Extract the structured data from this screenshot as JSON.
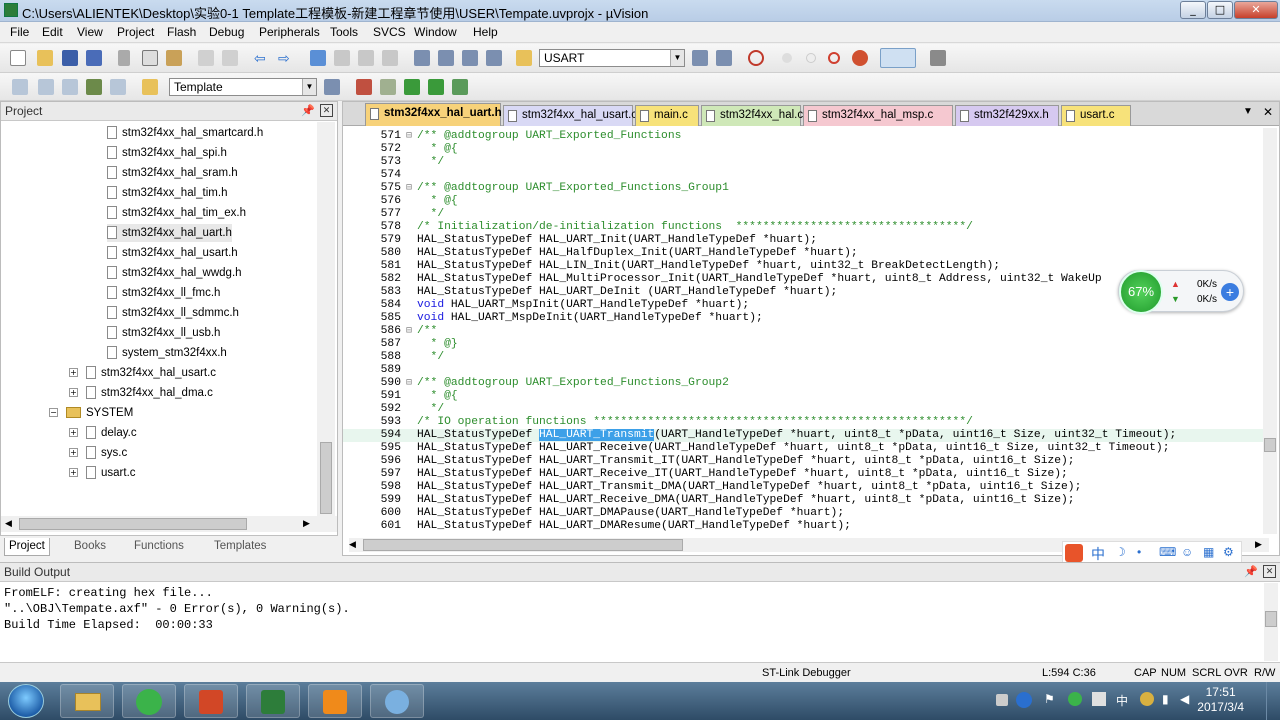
{
  "window": {
    "title": "C:\\Users\\ALIENTEK\\Desktop\\实验0-1 Template工程模板-新建工程章节使用\\USER\\Tempate.uvprojx - µVision"
  },
  "menu": [
    "File",
    "Edit",
    "View",
    "Project",
    "Flash",
    "Debug",
    "Peripherals",
    "Tools",
    "SVCS",
    "Window",
    "Help"
  ],
  "toolbar": {
    "find_value": "USART",
    "target_value": "Template"
  },
  "project_panel": {
    "title": "Project",
    "files": [
      "stm32f4xx_hal_smartcard.h",
      "stm32f4xx_hal_spi.h",
      "stm32f4xx_hal_sram.h",
      "stm32f4xx_hal_tim.h",
      "stm32f4xx_hal_tim_ex.h",
      "stm32f4xx_hal_uart.h",
      "stm32f4xx_hal_usart.h",
      "stm32f4xx_hal_wwdg.h",
      "stm32f4xx_ll_fmc.h",
      "stm32f4xx_ll_sdmmc.h",
      "stm32f4xx_ll_usb.h",
      "system_stm32f4xx.h"
    ],
    "sources": [
      "stm32f4xx_hal_usart.c",
      "stm32f4xx_hal_dma.c"
    ],
    "group": "SYSTEM",
    "group_files": [
      "delay.c",
      "sys.c",
      "usart.c"
    ],
    "tabs": [
      "Project",
      "Books",
      "Functions",
      "Templates"
    ]
  },
  "editor": {
    "tabs": [
      {
        "label": "stm32f4xx_hal_uart.h",
        "color": "#f7d27a",
        "active": true
      },
      {
        "label": "stm32f4xx_hal_usart.c",
        "color": "#d9d9f5"
      },
      {
        "label": "main.c",
        "color": "#f7e27a"
      },
      {
        "label": "stm32f4xx_hal.c",
        "color": "#cfe8b8"
      },
      {
        "label": "stm32f4xx_hal_msp.c",
        "color": "#f5c8d0"
      },
      {
        "label": "stm32f429xx.h",
        "color": "#d6c9f0"
      },
      {
        "label": "usart.c",
        "color": "#f7e27a"
      }
    ],
    "lines": [
      {
        "n": "571",
        "f": "⊟",
        "t": "/** @addtogroup UART_Exported_Functions",
        "c": "cmt"
      },
      {
        "n": "572",
        "f": "",
        "t": "  * @{",
        "c": "cmt"
      },
      {
        "n": "573",
        "f": "",
        "t": "  */",
        "c": "cmt"
      },
      {
        "n": "574",
        "f": "",
        "t": "",
        "c": ""
      },
      {
        "n": "575",
        "f": "⊟",
        "t": "/** @addtogroup UART_Exported_Functions_Group1",
        "c": "cmt"
      },
      {
        "n": "576",
        "f": "",
        "t": "  * @{",
        "c": "cmt"
      },
      {
        "n": "577",
        "f": "",
        "t": "  */",
        "c": "cmt"
      },
      {
        "n": "578",
        "f": "",
        "t": "/* Initialization/de-initialization functions  **********************************/",
        "c": "cmt"
      },
      {
        "n": "579",
        "f": "",
        "t": "HAL_StatusTypeDef HAL_UART_Init(UART_HandleTypeDef *huart);",
        "c": ""
      },
      {
        "n": "580",
        "f": "",
        "t": "HAL_StatusTypeDef HAL_HalfDuplex_Init(UART_HandleTypeDef *huart);",
        "c": ""
      },
      {
        "n": "581",
        "f": "",
        "t": "HAL_StatusTypeDef HAL_LIN_Init(UART_HandleTypeDef *huart, uint32_t BreakDetectLength);",
        "c": ""
      },
      {
        "n": "582",
        "f": "",
        "t": "HAL_StatusTypeDef HAL_MultiProcessor_Init(UART_HandleTypeDef *huart, uint8_t Address, uint32_t WakeUp",
        "c": ""
      },
      {
        "n": "583",
        "f": "",
        "t": "HAL_StatusTypeDef HAL_UART_DeInit (UART_HandleTypeDef *huart);",
        "c": ""
      },
      {
        "n": "584",
        "f": "",
        "t": "void HAL_UART_MspInit(UART_HandleTypeDef *huart);",
        "c": "void"
      },
      {
        "n": "585",
        "f": "",
        "t": "void HAL_UART_MspDeInit(UART_HandleTypeDef *huart);",
        "c": "void"
      },
      {
        "n": "586",
        "f": "⊟",
        "t": "/**",
        "c": "cmt"
      },
      {
        "n": "587",
        "f": "",
        "t": "  * @}",
        "c": "cmt"
      },
      {
        "n": "588",
        "f": "",
        "t": "  */",
        "c": "cmt"
      },
      {
        "n": "589",
        "f": "",
        "t": "",
        "c": ""
      },
      {
        "n": "590",
        "f": "⊟",
        "t": "/** @addtogroup UART_Exported_Functions_Group2",
        "c": "cmt"
      },
      {
        "n": "591",
        "f": "",
        "t": "  * @{",
        "c": "cmt"
      },
      {
        "n": "592",
        "f": "",
        "t": "  */",
        "c": "cmt"
      },
      {
        "n": "593",
        "f": "",
        "t": "/* IO operation functions *******************************************************/",
        "c": "cmt"
      },
      {
        "n": "594",
        "f": "",
        "t": "HAL_StatusTypeDef HAL_UART_Transmit(UART_HandleTypeDef *huart, uint8_t *pData, uint16_t Size, uint32_t Timeout);",
        "c": "hl"
      },
      {
        "n": "595",
        "f": "",
        "t": "HAL_StatusTypeDef HAL_UART_Receive(UART_HandleTypeDef *huart, uint8_t *pData, uint16_t Size, uint32_t Timeout);",
        "c": ""
      },
      {
        "n": "596",
        "f": "",
        "t": "HAL_StatusTypeDef HAL_UART_Transmit_IT(UART_HandleTypeDef *huart, uint8_t *pData, uint16_t Size);",
        "c": ""
      },
      {
        "n": "597",
        "f": "",
        "t": "HAL_StatusTypeDef HAL_UART_Receive_IT(UART_HandleTypeDef *huart, uint8_t *pData, uint16_t Size);",
        "c": ""
      },
      {
        "n": "598",
        "f": "",
        "t": "HAL_StatusTypeDef HAL_UART_Transmit_DMA(UART_HandleTypeDef *huart, uint8_t *pData, uint16_t Size);",
        "c": ""
      },
      {
        "n": "599",
        "f": "",
        "t": "HAL_StatusTypeDef HAL_UART_Receive_DMA(UART_HandleTypeDef *huart, uint8_t *pData, uint16_t Size);",
        "c": ""
      },
      {
        "n": "600",
        "f": "",
        "t": "HAL_StatusTypeDef HAL_UART_DMAPause(UART_HandleTypeDef *huart);",
        "c": ""
      },
      {
        "n": "601",
        "f": "",
        "t": "HAL_StatusTypeDef HAL_UART_DMAResume(UART_HandleTypeDef *huart);",
        "c": ""
      }
    ]
  },
  "build": {
    "title": "Build Output",
    "text": "FromELF: creating hex file...\n\"..\\OBJ\\Tempate.axf\" - 0 Error(s), 0 Warning(s).\nBuild Time Elapsed:  00:00:33"
  },
  "status": {
    "debugger": "ST-Link Debugger",
    "position": "L:594 C:36",
    "flags": [
      "CAP",
      "NUM",
      "SCRL",
      "OVR",
      "R/W"
    ]
  },
  "net_widget": {
    "percent": "67%",
    "up": "0K/s",
    "down": "0K/s"
  },
  "taskbar": {
    "time": "17:51",
    "date": "2017/3/4"
  },
  "ime": {
    "lang": "中"
  }
}
